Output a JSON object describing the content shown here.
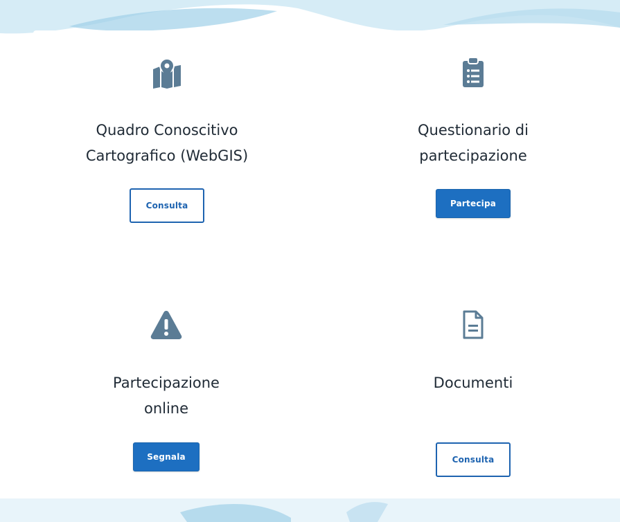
{
  "colors": {
    "primary": "#1d6fc1",
    "icon": "#5b7c95",
    "title_text": "#1f2a35"
  },
  "cards": [
    {
      "icon": "map-marker-icon",
      "title_line1": "Quadro Conoscitivo",
      "title_line2": "Cartografico (WebGIS)",
      "button_label": "Consulta",
      "button_style": "outline"
    },
    {
      "icon": "clipboard-list-icon",
      "title_line1": "Questionario di",
      "title_line2": "partecipazione",
      "button_label": "Partecipa",
      "button_style": "solid"
    },
    {
      "icon": "warning-triangle-icon",
      "title_line1": "Partecipazione",
      "title_line2": "online",
      "button_label": "Segnala",
      "button_style": "solid"
    },
    {
      "icon": "document-icon",
      "title_line1": "Documenti",
      "title_line2": "",
      "button_label": "Consulta",
      "button_style": "outline"
    }
  ]
}
